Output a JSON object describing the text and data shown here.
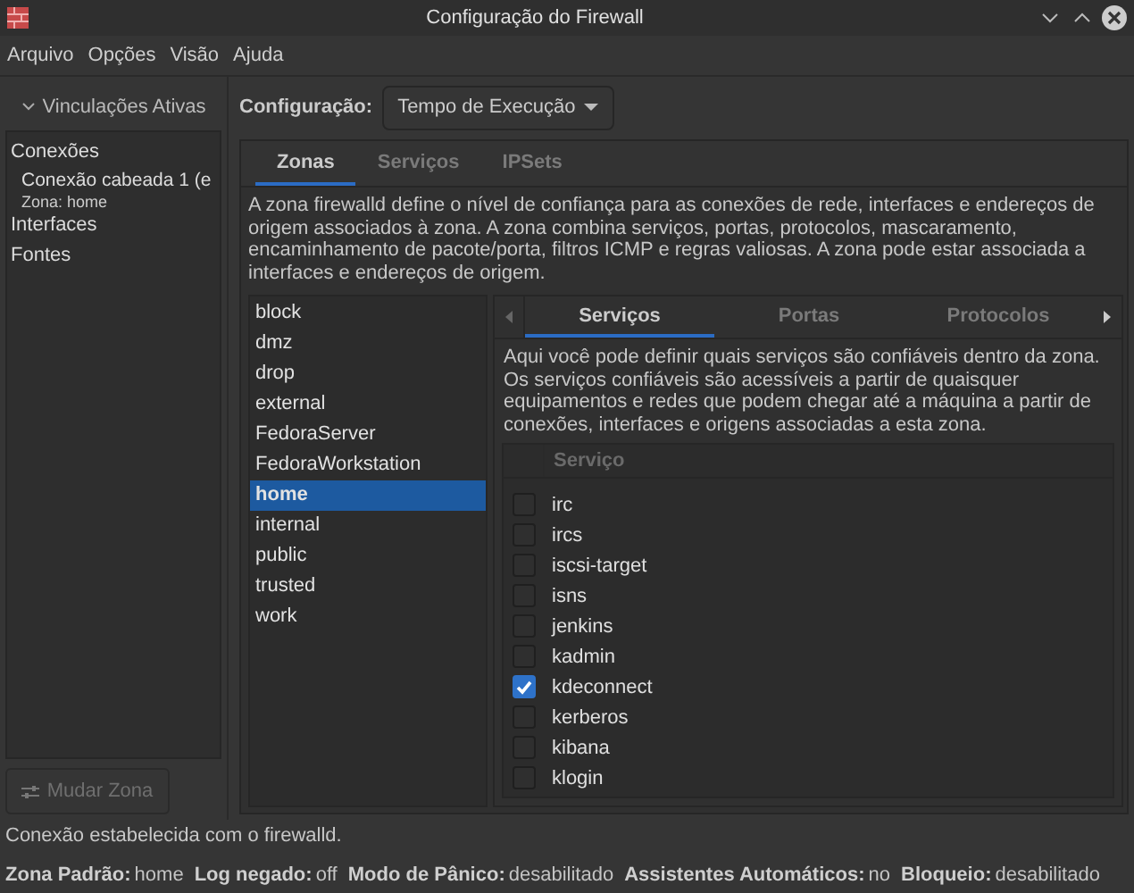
{
  "window": {
    "title": "Configuração do Firewall"
  },
  "menu": [
    "Arquivo",
    "Opções",
    "Visão",
    "Ajuda"
  ],
  "bindings": {
    "header": "Vinculações Ativas",
    "expanded": true,
    "items": [
      {
        "label": "Conexões",
        "children": [
          {
            "label": "Conexão cabeada 1 (e",
            "zone": "Zona: home"
          }
        ]
      },
      {
        "label": "Interfaces"
      },
      {
        "label": "Fontes"
      }
    ],
    "button": {
      "label": "Mudar Zona",
      "disabled": true
    }
  },
  "configuration": {
    "label": "Configuração:",
    "value": "Tempo de Execução"
  },
  "tabs": [
    {
      "label": "Zonas",
      "selected": true
    },
    {
      "label": "Serviços",
      "selected": false
    },
    {
      "label": "IPSets",
      "selected": false
    }
  ],
  "description": "A zona firewalld define o nível de confiança para as conexões de rede, interfaces e endereços de origem associados à zona. A zona combina serviços, portas, protocolos, mascaramento, encaminhamento de pacote/porta, filtros ICMP e regras valiosas. A zona pode estar associada a interfaces e endereços de origem.",
  "zones": [
    {
      "label": "block",
      "selected": false
    },
    {
      "label": "dmz",
      "selected": false
    },
    {
      "label": "drop",
      "selected": false
    },
    {
      "label": "external",
      "selected": false
    },
    {
      "label": "FedoraServer",
      "selected": false
    },
    {
      "label": "FedoraWorkstation",
      "selected": false
    },
    {
      "label": "home",
      "selected": true
    },
    {
      "label": "internal",
      "selected": false
    },
    {
      "label": "public",
      "selected": false
    },
    {
      "label": "trusted",
      "selected": false
    },
    {
      "label": "work",
      "selected": false
    }
  ],
  "zone_tabs": [
    {
      "label": "Serviços",
      "selected": true
    },
    {
      "label": "Portas",
      "selected": false
    },
    {
      "label": "Protocolos",
      "selected": false
    }
  ],
  "services_description": "Aqui você pode definir quais serviços são confiáveis dentro da zona. Os serviços confiáveis são acessíveis a partir de quaisquer equipamentos e redes que podem chegar até a máquina a partir de conexões, interfaces e origens associadas a esta zona.",
  "services_table": {
    "columns": [
      "Serviço"
    ],
    "rows": [
      {
        "name": "irc",
        "checked": false
      },
      {
        "name": "ircs",
        "checked": false
      },
      {
        "name": "iscsi-target",
        "checked": false
      },
      {
        "name": "isns",
        "checked": false
      },
      {
        "name": "jenkins",
        "checked": false
      },
      {
        "name": "kadmin",
        "checked": false
      },
      {
        "name": "kdeconnect",
        "checked": true
      },
      {
        "name": "kerberos",
        "checked": false
      },
      {
        "name": "kibana",
        "checked": false
      },
      {
        "name": "klogin",
        "checked": false
      }
    ]
  },
  "status_message": "Conexão estabelecida com o firewalld.",
  "status_bar": [
    {
      "label": "Zona Padrão:",
      "value": "home"
    },
    {
      "label": "Log negado:",
      "value": "off"
    },
    {
      "label": "Modo de Pânico:",
      "value": "desabilitado"
    },
    {
      "label": "Assistentes Automáticos:",
      "value": "no"
    },
    {
      "label": "Bloqueio:",
      "value": "desabilitado"
    }
  ]
}
